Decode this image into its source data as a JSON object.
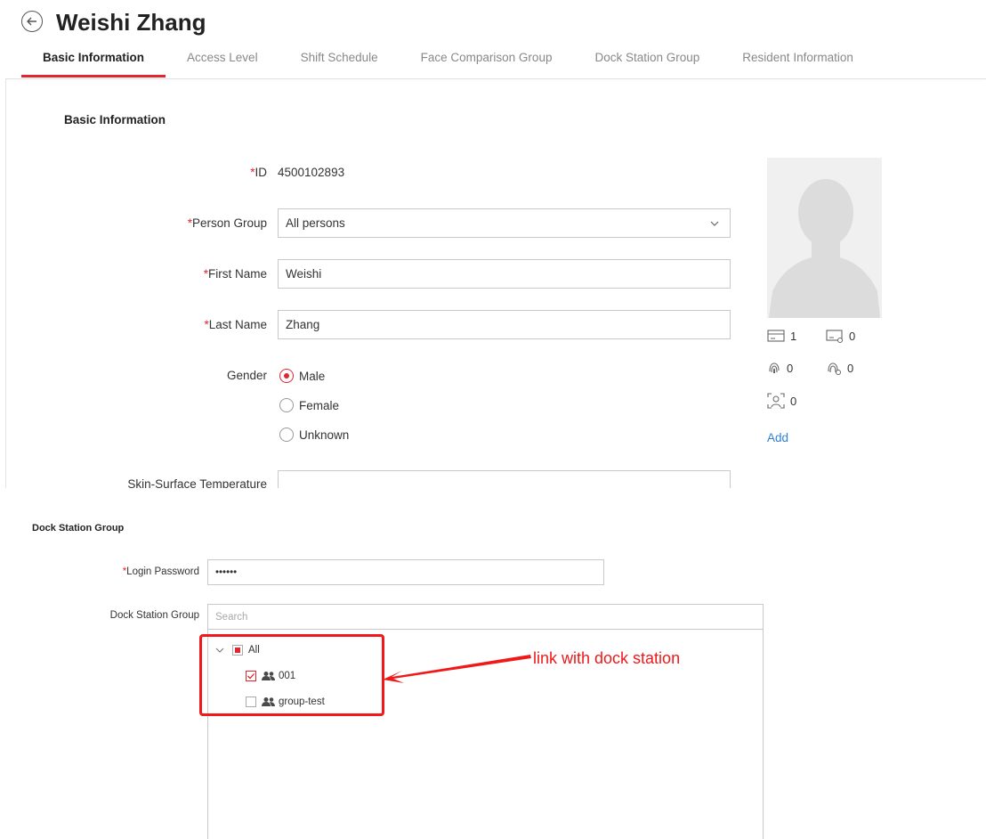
{
  "header": {
    "title": "Weishi Zhang"
  },
  "tabs": [
    "Basic Information",
    "Access Level",
    "Shift Schedule",
    "Face Comparison Group",
    "Dock Station Group",
    "Resident Information"
  ],
  "basic": {
    "section_title": "Basic Information",
    "id_label": "ID",
    "id_value": "4500102893",
    "person_group_label": "Person Group",
    "person_group_value": "All persons",
    "first_name_label": "First Name",
    "first_name_value": "Weishi",
    "last_name_label": "Last Name",
    "last_name_value": "Zhang",
    "gender_label": "Gender",
    "gender_options": [
      "Male",
      "Female",
      "Unknown"
    ],
    "gender_selected": "Male",
    "skin_temp_label": "Skin-Surface Temperature",
    "required_mark": "*"
  },
  "credentials": {
    "card_count": "1",
    "card2_count": "0",
    "fingerprint_count": "0",
    "fingerprint2_count": "0",
    "face_count": "0",
    "add_label": "Add"
  },
  "dock": {
    "section_title": "Dock Station Group",
    "login_password_label": "Login Password",
    "login_password_value": "••••••",
    "dock_group_label": "Dock Station Group",
    "search_placeholder": "Search",
    "tree": {
      "root": "All",
      "items": [
        "001",
        "group-test"
      ],
      "checked": [
        "001"
      ]
    },
    "annotation": "link with dock station"
  },
  "colors": {
    "accent": "#e0262e",
    "link": "#2f7fd6",
    "annotation": "#f01818"
  }
}
